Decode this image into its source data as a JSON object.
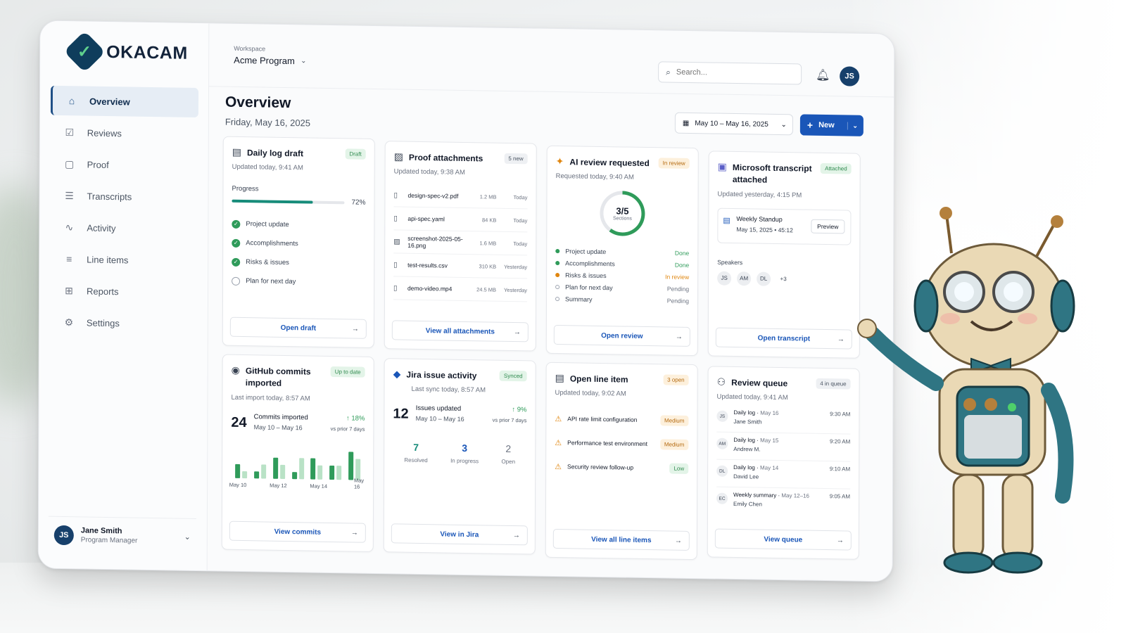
{
  "app": {
    "brand": "OKACAM"
  },
  "sidebar": {
    "items": [
      {
        "label": "Overview",
        "icon": "home-icon",
        "active": true
      },
      {
        "label": "Reviews",
        "icon": "review-icon"
      },
      {
        "label": "Proof",
        "icon": "proof-icon"
      },
      {
        "label": "Transcripts",
        "icon": "transcript-icon"
      },
      {
        "label": "Activity",
        "icon": "activity-icon"
      },
      {
        "label": "Line items",
        "icon": "list-icon"
      },
      {
        "label": "Reports",
        "icon": "report-icon"
      },
      {
        "label": "Settings",
        "icon": "gear-icon"
      }
    ],
    "user": {
      "initials": "JS",
      "name": "Jane Smith",
      "role": "Program Manager"
    }
  },
  "topbar": {
    "workspace_label": "Workspace",
    "workspace": "Acme Program",
    "search_placeholder": "Search...",
    "avatar": "JS"
  },
  "page": {
    "title": "Overview",
    "date": "Friday, May 16, 2025",
    "date_range": "May 10 – May 16, 2025",
    "new_label": "New"
  },
  "colors": {
    "accent": "#1a56b8",
    "brand": "#0f3d5c",
    "success": "#2f9b5a",
    "warning": "#e0860f"
  },
  "cards": {
    "daily": {
      "title": "Daily log draft",
      "badge": "Draft",
      "updated": "Updated today, 9:41 AM",
      "progress_label": "Progress",
      "progress": 0.72,
      "progress_text": "72%",
      "items": [
        {
          "label": "Project update",
          "done": true
        },
        {
          "label": "Accomplishments",
          "done": true
        },
        {
          "label": "Risks & issues",
          "done": true
        },
        {
          "label": "Plan for next day",
          "done": false
        }
      ],
      "action": "Open draft"
    },
    "proof": {
      "title": "Proof attachments",
      "badge": "5 new",
      "updated": "Updated today, 9:38 AM",
      "files": [
        {
          "name": "design-spec-v2.pdf",
          "size": "1.2 MB",
          "date": "Today"
        },
        {
          "name": "api-spec.yaml",
          "size": "84 KB",
          "date": "Today"
        },
        {
          "name": "screenshot-2025-05-16.png",
          "size": "1.6 MB",
          "date": "Today"
        },
        {
          "name": "test-results.csv",
          "size": "310 KB",
          "date": "Yesterday"
        },
        {
          "name": "demo-video.mp4",
          "size": "24.5 MB",
          "date": "Yesterday"
        }
      ],
      "action": "View all attachments"
    },
    "ai": {
      "title": "AI review requested",
      "badge": "In review",
      "updated": "Requested today, 9:40 AM",
      "ring_value": "3/5",
      "ring_label": "Sections",
      "ring_fraction": 0.6,
      "items": [
        {
          "label": "Project update",
          "status": "Done"
        },
        {
          "label": "Accomplishments",
          "status": "Done"
        },
        {
          "label": "Risks & issues",
          "status": "In review"
        },
        {
          "label": "Plan for next day",
          "status": "Pending"
        },
        {
          "label": "Summary",
          "status": "Pending"
        }
      ],
      "action": "Open review"
    },
    "ms": {
      "title": "Microsoft transcript attached",
      "badge": "Attached",
      "updated": "Updated yesterday, 4:15 PM",
      "meeting": "Weekly Standup",
      "meeting_date": "May 15, 2025",
      "duration": "45:12",
      "preview": "Preview",
      "speakers_label": "Speakers",
      "speakers": [
        "JS",
        "AM",
        "DL",
        "+3"
      ],
      "action": "Open transcript"
    },
    "github": {
      "title": "GitHub commits imported",
      "badge": "Up to date",
      "updated": "Last import today, 8:57 AM",
      "value": "24",
      "label": "Commits imported",
      "range": "May 10 – May 16",
      "delta": "18%",
      "delta_label": "vs prior 7 days",
      "action": "View commits"
    },
    "jira": {
      "title": "Jira issue activity",
      "badge": "Synced",
      "updated": "Last sync today, 8:57 AM",
      "value": "12",
      "label": "Issues updated",
      "range": "May 10 – May 16",
      "delta": "9%",
      "delta_label": "vs prior 7 days",
      "stats": [
        {
          "value": "7",
          "label": "Resolved"
        },
        {
          "value": "3",
          "label": "In progress"
        },
        {
          "value": "2",
          "label": "Open"
        }
      ],
      "action": "View in Jira"
    },
    "line": {
      "title": "Open line item",
      "badge": "3 open",
      "updated": "Updated today, 9:02 AM",
      "items": [
        {
          "label": "API rate limit configuration",
          "priority": "Medium"
        },
        {
          "label": "Performance test environment",
          "priority": "Medium"
        },
        {
          "label": "Security review follow-up",
          "priority": "Low"
        }
      ],
      "action": "View all line items"
    },
    "queue": {
      "title": "Review queue",
      "badge": "4 in queue",
      "updated": "Updated today, 9:41 AM",
      "items": [
        {
          "initials": "JS",
          "type": "Daily log",
          "date": "May 16",
          "name": "Jane Smith",
          "time": "9:30 AM"
        },
        {
          "initials": "AM",
          "type": "Daily log",
          "date": "May 15",
          "name": "Andrew M.",
          "time": "9:20 AM"
        },
        {
          "initials": "DL",
          "type": "Daily log",
          "date": "May 14",
          "name": "David Lee",
          "time": "9:10 AM"
        },
        {
          "initials": "EC",
          "type": "Weekly summary",
          "date": "May 12–16",
          "name": "Emily Chen",
          "time": "9:05 AM"
        }
      ],
      "action": "View queue"
    }
  },
  "chart_data": {
    "type": "bar",
    "categories": [
      "May 10",
      "",
      "May 12",
      "",
      "May 14",
      "",
      "May 16"
    ],
    "series": [
      {
        "values": [
          2,
          1,
          3,
          1,
          3,
          2,
          4
        ]
      },
      {
        "values": [
          1,
          2,
          2,
          3,
          2,
          2,
          3
        ]
      }
    ],
    "tick_labels": [
      "May 10",
      "May 12",
      "May 14",
      "May 16"
    ]
  }
}
